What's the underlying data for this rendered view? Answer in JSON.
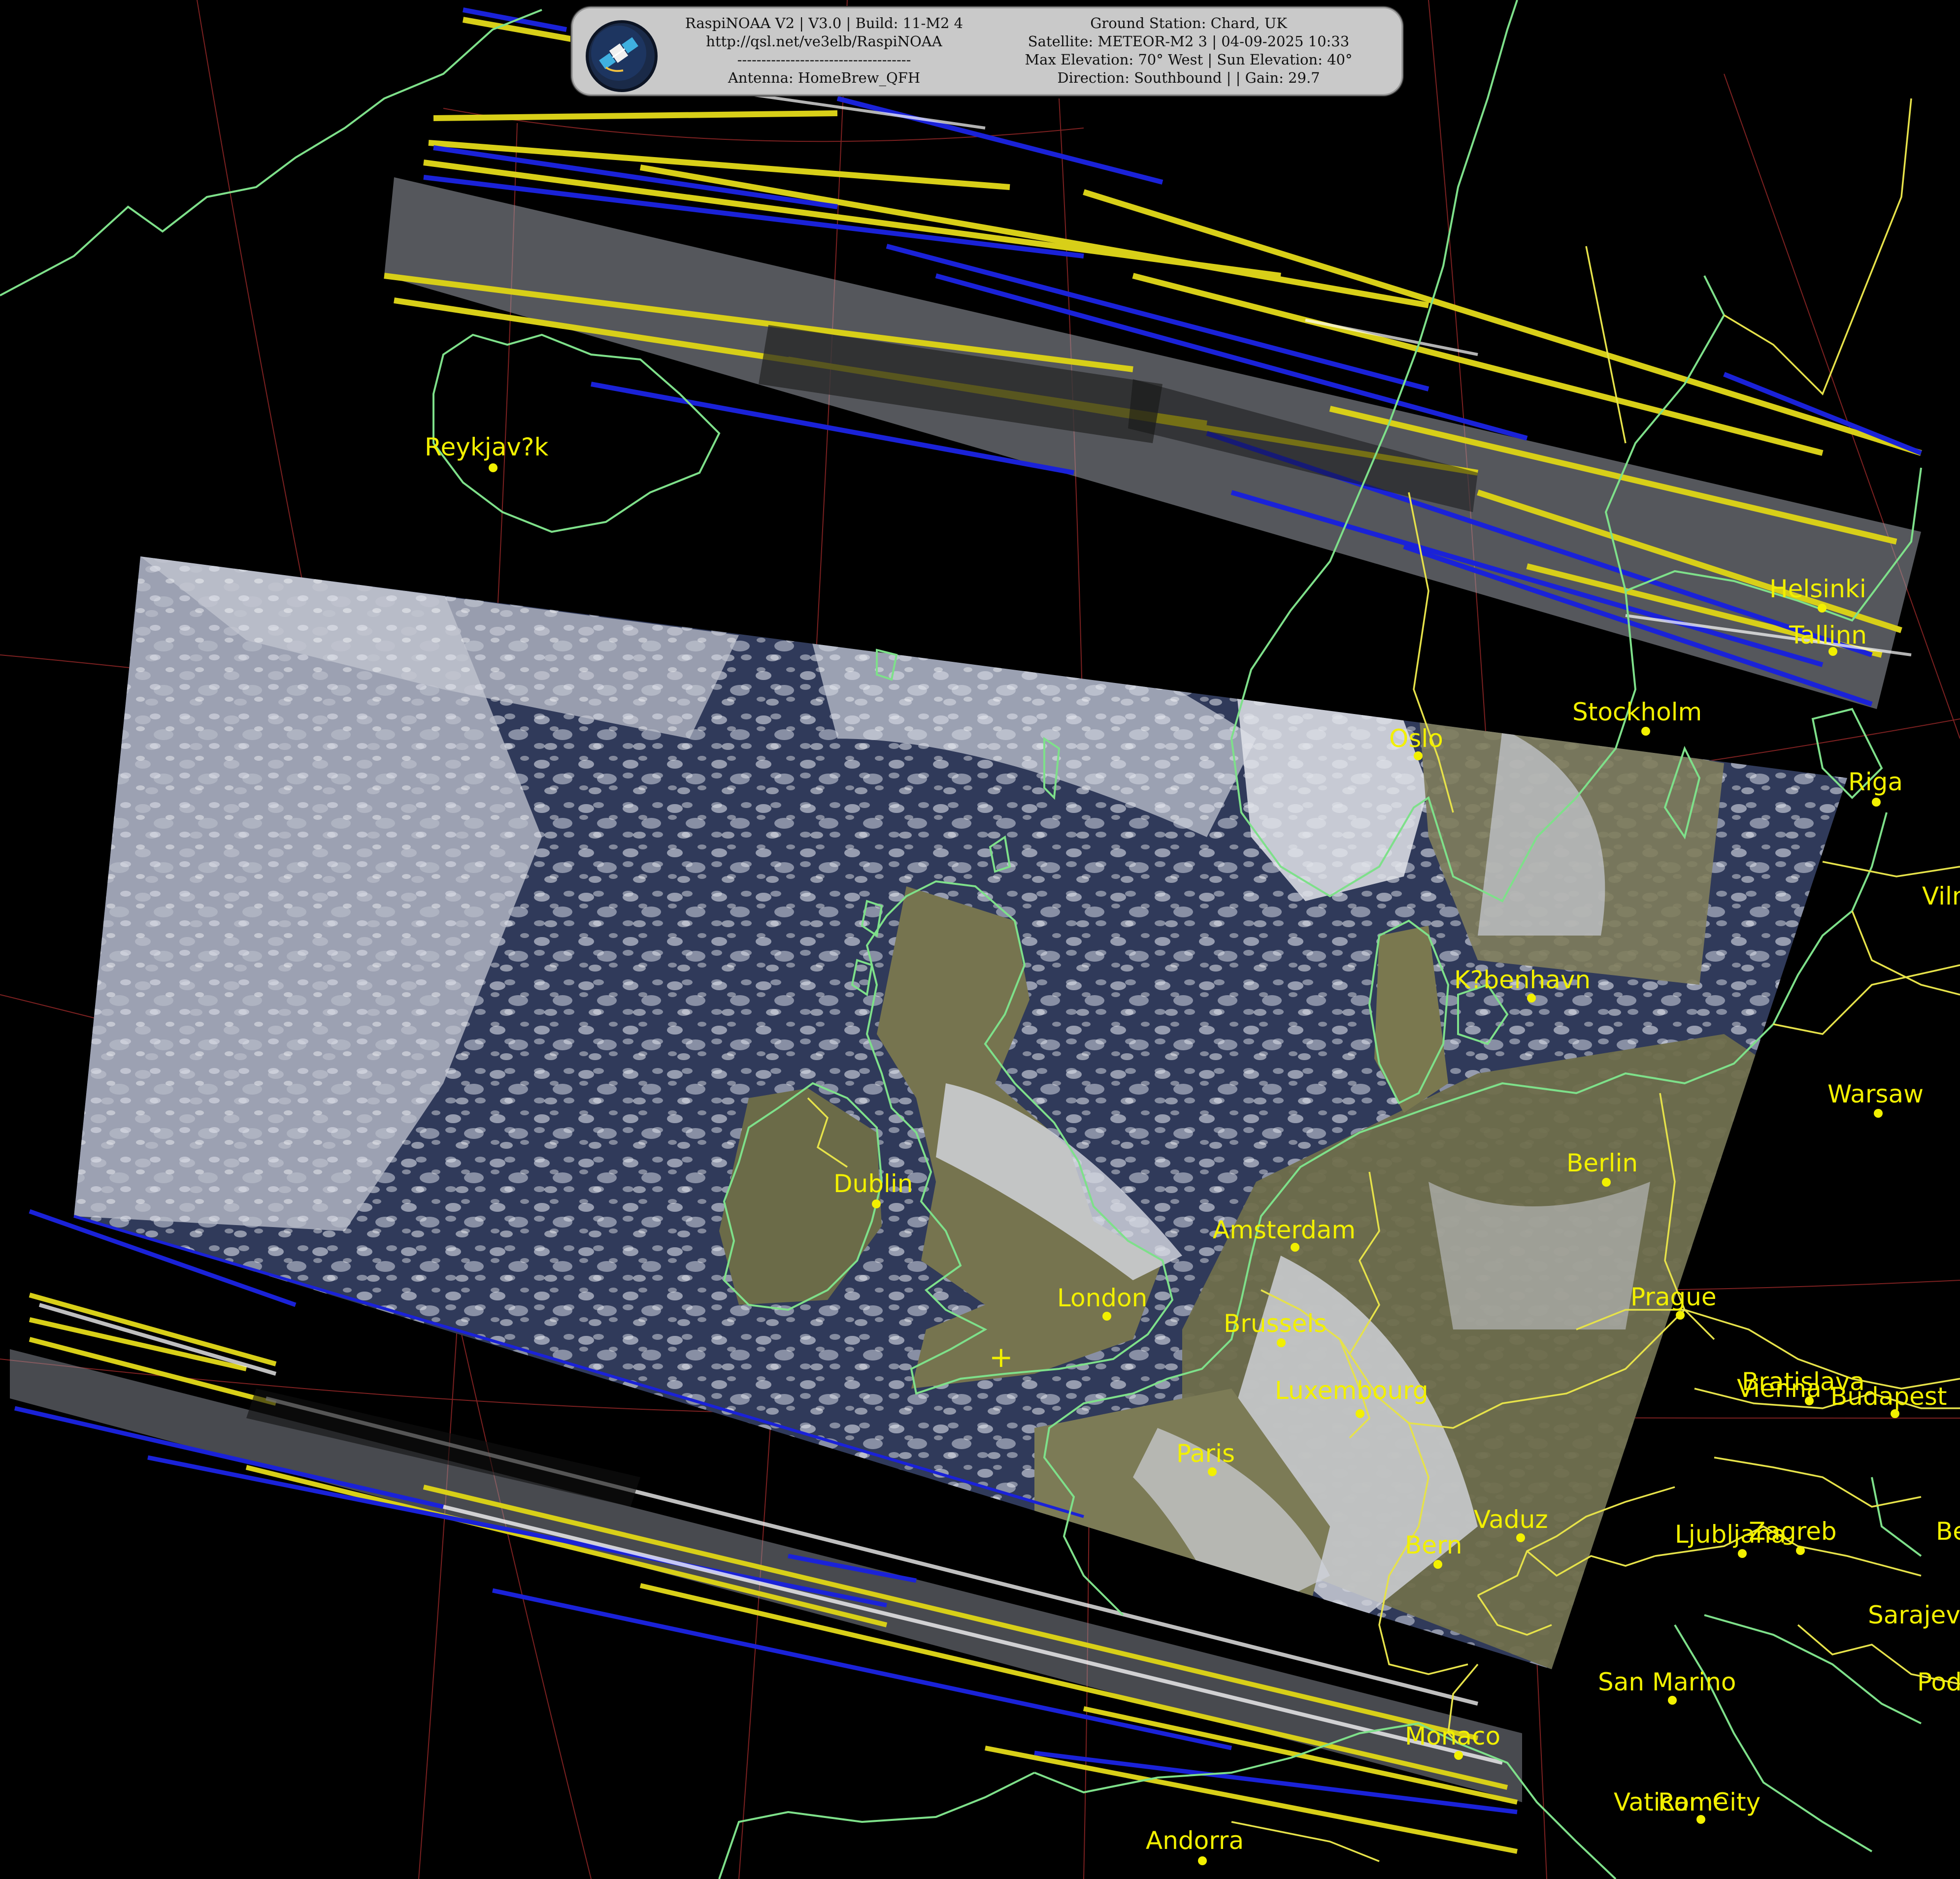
{
  "header": {
    "left_lines": [
      "RaspiNOAA V2 | V3.0 | Build: 11-M2 4",
      "http://qsl.net/ve3elb/RaspiNOAA",
      "------------------------------------",
      "Antenna: HomeBrew_QFH"
    ],
    "right_lines": [
      "Ground Station: Chard, UK",
      "Satellite: METEOR-M2 3 | 04-09-2025 10:33",
      "Max Elevation: 70° West | Sun Elevation: 40°",
      "Direction: Southbound | | Gain: 29.7"
    ],
    "logo_icon": "satellite-icon"
  },
  "map": {
    "station_marker": "+",
    "colors": {
      "coastline": "#7ee08a",
      "borders": "#e6e24a",
      "labels": "#f2f000",
      "graticule": "#8b2525",
      "noise_yellow": "#d8cf18",
      "noise_blue": "#1a22d8"
    },
    "cities": [
      {
        "name": "Reykjav?k"
      },
      {
        "name": "Helsinki"
      },
      {
        "name": "Tallinn"
      },
      {
        "name": "Stockholm"
      },
      {
        "name": "Oslo"
      },
      {
        "name": "Riga"
      },
      {
        "name": "Viln"
      },
      {
        "name": "K?benhavn"
      },
      {
        "name": "Warsaw"
      },
      {
        "name": "Berlin"
      },
      {
        "name": "Dublin"
      },
      {
        "name": "Amsterdam"
      },
      {
        "name": "London"
      },
      {
        "name": "Prague"
      },
      {
        "name": "Brussels"
      },
      {
        "name": "Luxembourg"
      },
      {
        "name": "Bratislava"
      },
      {
        "name": "Vienna"
      },
      {
        "name": "Budapest"
      },
      {
        "name": "Paris"
      },
      {
        "name": "Vaduz"
      },
      {
        "name": "Bern"
      },
      {
        "name": "Ljubljana"
      },
      {
        "name": "Zagreb"
      },
      {
        "name": "Sarajev"
      },
      {
        "name": "San Marino"
      },
      {
        "name": "Pod"
      },
      {
        "name": "Be"
      },
      {
        "name": "Monaco"
      },
      {
        "name": "Vatican City"
      },
      {
        "name": "Rome"
      },
      {
        "name": "Andorra"
      }
    ]
  }
}
